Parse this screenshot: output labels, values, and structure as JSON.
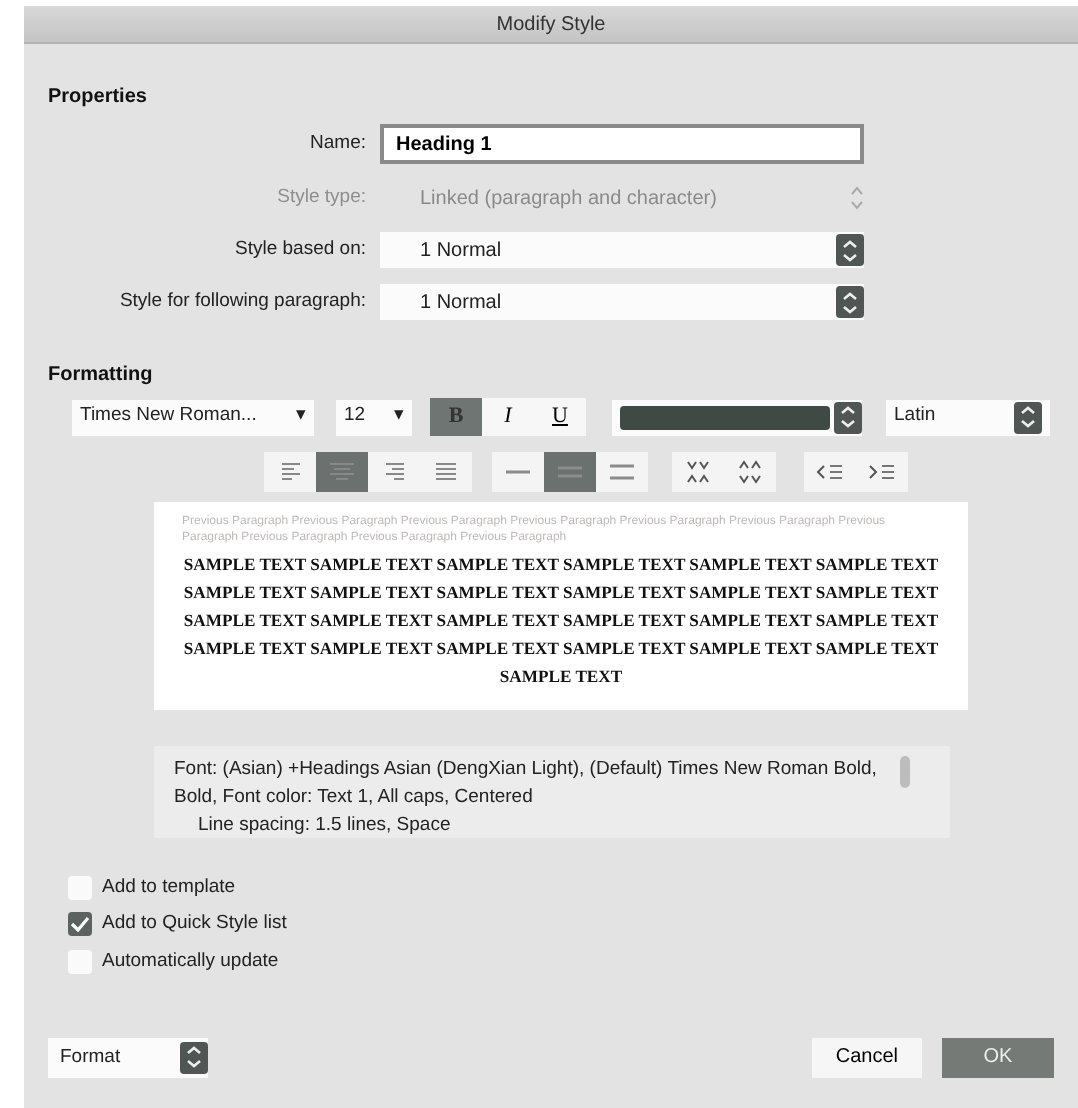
{
  "window": {
    "title": "Modify Style"
  },
  "properties": {
    "heading": "Properties",
    "name": {
      "label": "Name:",
      "value": "Heading 1"
    },
    "style_type": {
      "label": "Style type:",
      "value": "Linked (paragraph and character)",
      "disabled": true
    },
    "style_based_on": {
      "label": "Style based on:",
      "value": "1 Normal"
    },
    "following": {
      "label": "Style for following paragraph:",
      "value": "1 Normal"
    }
  },
  "formatting": {
    "heading": "Formatting",
    "font": {
      "value": "Times New Roman...",
      "arrow": "▾"
    },
    "size": {
      "value": "12",
      "arrow": "▾"
    },
    "styles": [
      {
        "label": "B",
        "kind": "bold",
        "selected": true
      },
      {
        "label": "I",
        "kind": "italic",
        "selected": false
      },
      {
        "label": "U",
        "kind": "underline",
        "selected": false
      }
    ],
    "script": {
      "value": "Latin"
    },
    "alignment": [
      {
        "kind": "left",
        "selected": false
      },
      {
        "kind": "center",
        "selected": true
      },
      {
        "kind": "right",
        "selected": false
      },
      {
        "kind": "justify",
        "selected": false
      }
    ],
    "line_spacing": [
      {
        "kind": "single",
        "selected": false
      },
      {
        "kind": "one-half",
        "selected": true
      },
      {
        "kind": "double",
        "selected": false
      }
    ],
    "paragraph_spacing": [
      {
        "kind": "decrease"
      },
      {
        "kind": "increase"
      }
    ],
    "indent": [
      {
        "kind": "decrease"
      },
      {
        "kind": "increase"
      }
    ]
  },
  "preview": {
    "previous": "Previous Paragraph Previous Paragraph Previous Paragraph Previous Paragraph Previous Paragraph Previous Paragraph Previous Paragraph Previous Paragraph Previous Paragraph Previous Paragraph",
    "sample_lines": [
      "SAMPLE TEXT SAMPLE TEXT SAMPLE TEXT SAMPLE TEXT SAMPLE TEXT SAMPLE TEXT",
      "SAMPLE TEXT SAMPLE TEXT SAMPLE TEXT SAMPLE TEXT SAMPLE TEXT SAMPLE TEXT",
      "SAMPLE TEXT SAMPLE TEXT SAMPLE TEXT SAMPLE TEXT SAMPLE TEXT SAMPLE TEXT",
      "SAMPLE TEXT SAMPLE TEXT SAMPLE TEXT SAMPLE TEXT SAMPLE TEXT SAMPLE TEXT",
      "SAMPLE TEXT"
    ]
  },
  "description": [
    "Font: (Asian) +Headings Asian (DengXian Light), (Default) Times New Roman Bold, Bold, Font color: Text 1, All caps, Centered",
    "Line spacing:  1.5 lines, Space"
  ],
  "options": [
    {
      "label": "Add to template",
      "checked": false
    },
    {
      "label": "Add to Quick Style list",
      "checked": true
    },
    {
      "label": "Automatically update",
      "checked": false
    }
  ],
  "buttons": {
    "format": "Format",
    "cancel": "Cancel",
    "ok": "OK"
  }
}
